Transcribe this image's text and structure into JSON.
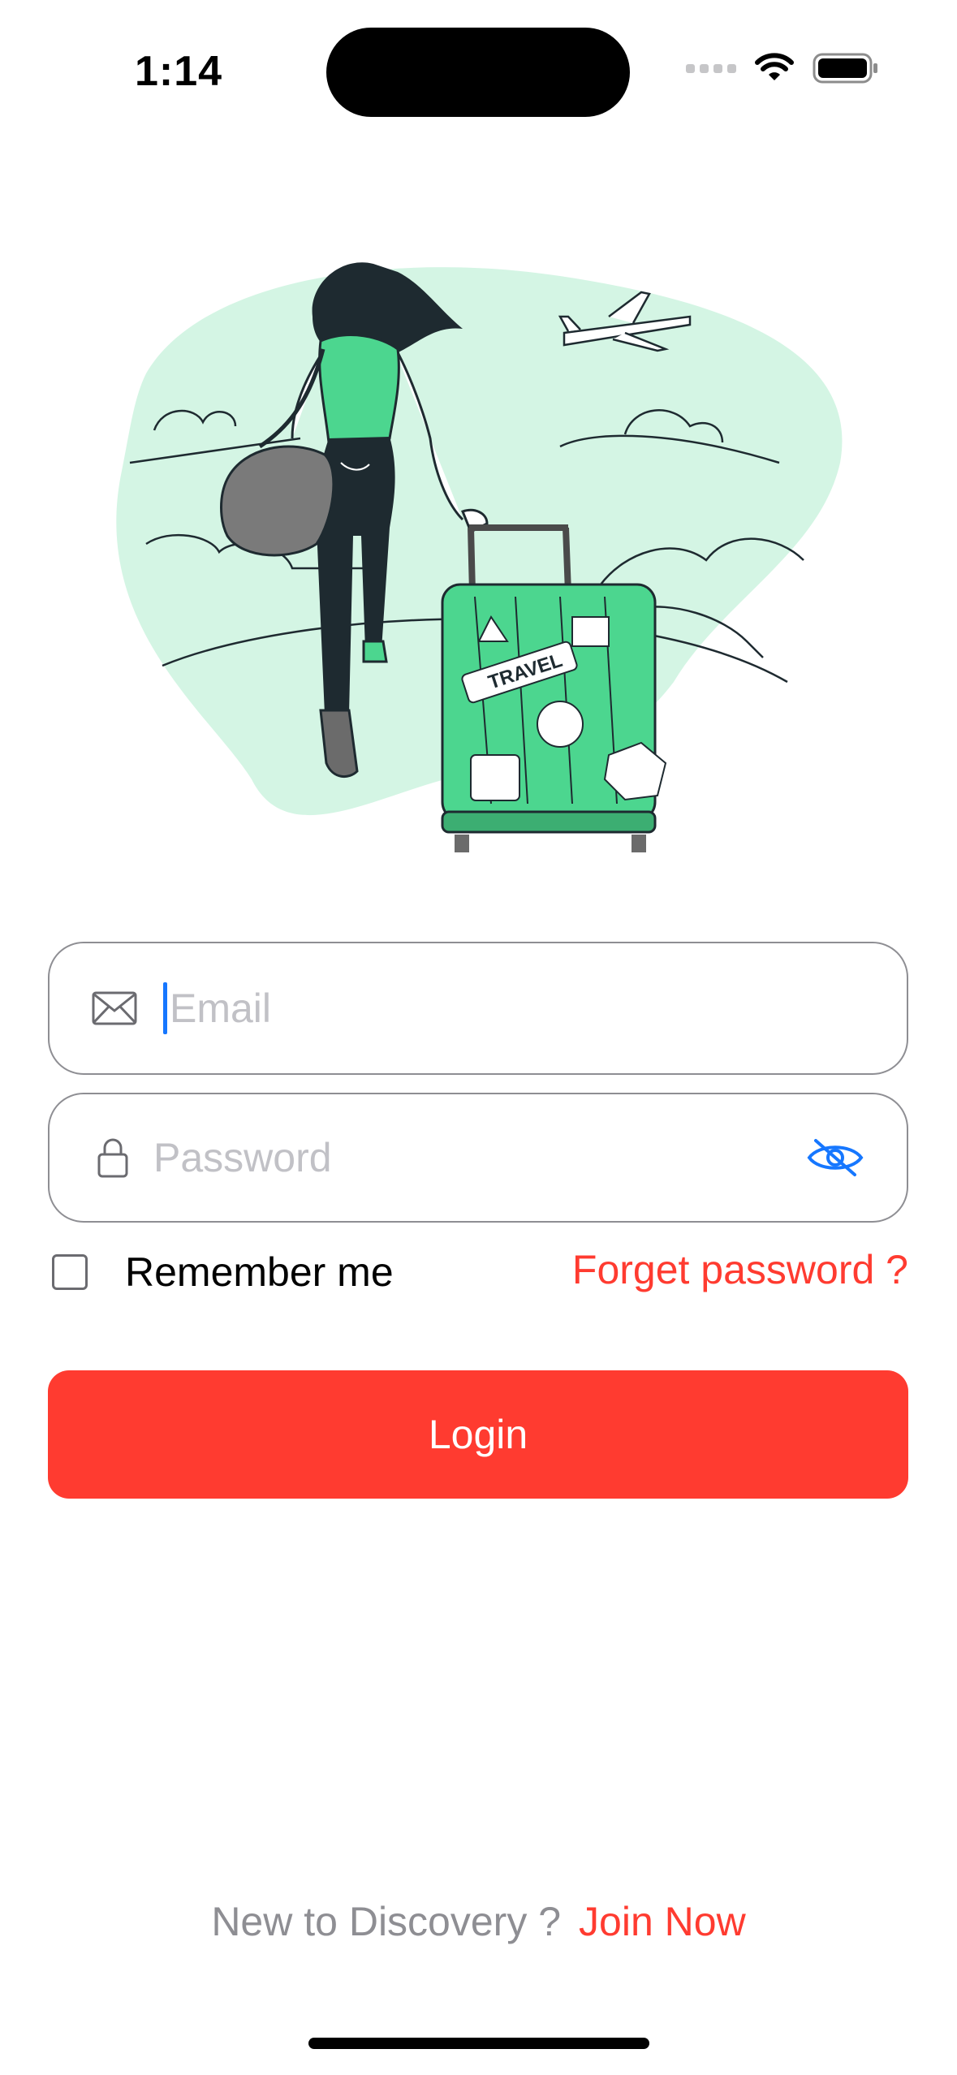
{
  "status_bar": {
    "time": "1:14",
    "icons": [
      "cellular-signal-icon",
      "wifi-icon",
      "battery-icon"
    ]
  },
  "hero": {
    "description_icon": "traveler-with-suitcase-illustration",
    "accent_color": "#d4f5e4",
    "suitcase_color": "#4cd68f",
    "sticker_text": "TRAVEL"
  },
  "form": {
    "email": {
      "placeholder": "Email",
      "value": "",
      "icon": "envelope-icon"
    },
    "password": {
      "placeholder": "Password",
      "value": "",
      "icon": "lock-icon",
      "toggle_icon": "eye-slash-icon"
    },
    "remember_label": "Remember me",
    "remember_checked": false,
    "forgot_label": "Forget password ?",
    "login_label": "Login"
  },
  "footer": {
    "prompt": "New to Discovery ?",
    "join_label": "Join Now"
  },
  "colors": {
    "accent": "#ff3b30",
    "link_blue": "#1677ff",
    "border": "#8e8e93"
  }
}
